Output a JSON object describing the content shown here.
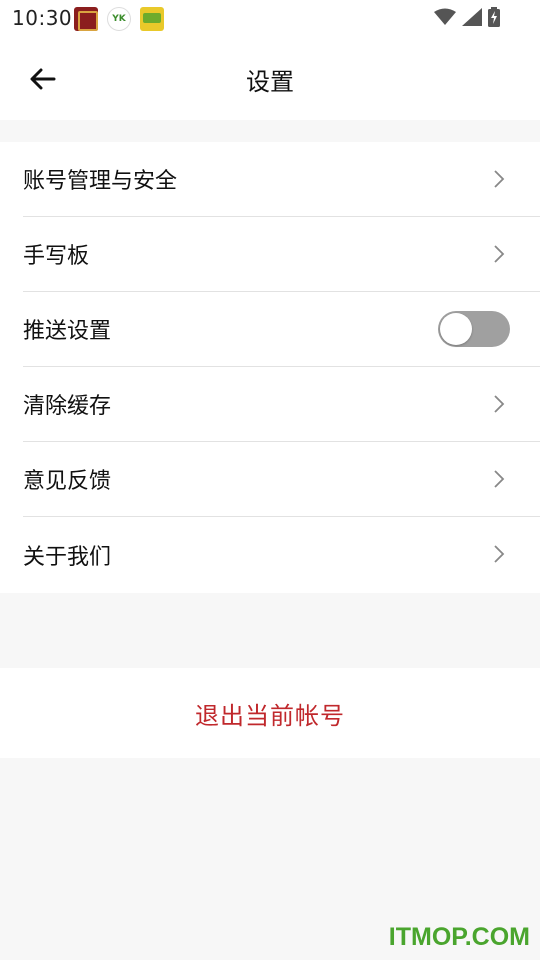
{
  "status_bar": {
    "time": "10:30",
    "icons": [
      "wifi-icon",
      "signal-icon",
      "battery-charging-icon"
    ],
    "notification_icons": [
      "app-notification-1",
      "yk-app-notification",
      "app-notification-3"
    ],
    "notif2_text": "YK"
  },
  "header": {
    "title": "设置",
    "back_icon": "arrow-left-icon"
  },
  "menu": {
    "items": [
      {
        "label": "账号管理与安全",
        "control": "chevron"
      },
      {
        "label": "手写板",
        "control": "chevron"
      },
      {
        "label": "推送设置",
        "control": "toggle",
        "toggle_on": false
      },
      {
        "label": "清除缓存",
        "control": "chevron"
      },
      {
        "label": "意见反馈",
        "control": "chevron"
      },
      {
        "label": "关于我们",
        "control": "chevron"
      }
    ]
  },
  "logout": {
    "label": "退出当前帐号"
  },
  "watermark": "ITMOP.COM",
  "colors": {
    "accent_red": "#c0282c",
    "background": "#f7f7f7",
    "toggle_off": "#a0a0a0",
    "watermark_green": "#4aa52e"
  }
}
